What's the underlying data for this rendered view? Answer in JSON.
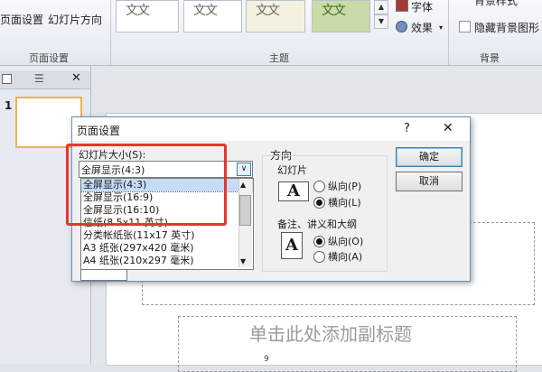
{
  "ribbon": {
    "page_setup_label": "页面设置",
    "orientation_label": "幻灯片方向",
    "group_page_setup": "页面设置",
    "group_themes": "主题",
    "group_background": "背景",
    "font_label": "字体",
    "effects_label": "效果",
    "bg_styles_label": "背景样式",
    "hide_bg_label": "隐藏背景图形",
    "theme_thumb_text": "文文"
  },
  "left_pane": {
    "slide_number": "1"
  },
  "slide": {
    "subtitle_placeholder": "单击此处添加副标题",
    "small_number": "9"
  },
  "dialog": {
    "title": "页面设置",
    "help_glyph": "?",
    "close_glyph": "✕",
    "size_label": "幻灯片大小(S):",
    "size_selected": "全屏显示(4:3)",
    "size_options": [
      "全屏显示(4:3)",
      "全屏显示(16:9)",
      "全屏显示(16:10)",
      "信纸(8.5x11 英寸)",
      "分类帐纸张(11x17 英寸)",
      "A3 纸张(297x420 毫米)",
      "A4 纸张(210x297 毫米)"
    ],
    "orientation_title": "方向",
    "slides_group": "幻灯片",
    "portrait": "纵向(P)",
    "landscape": "横向(L)",
    "notes_group": "备注、讲义和大纲",
    "notes_portrait": "纵向(O)",
    "notes_landscape": "横向(A)",
    "ok": "确定",
    "cancel": "取消"
  }
}
